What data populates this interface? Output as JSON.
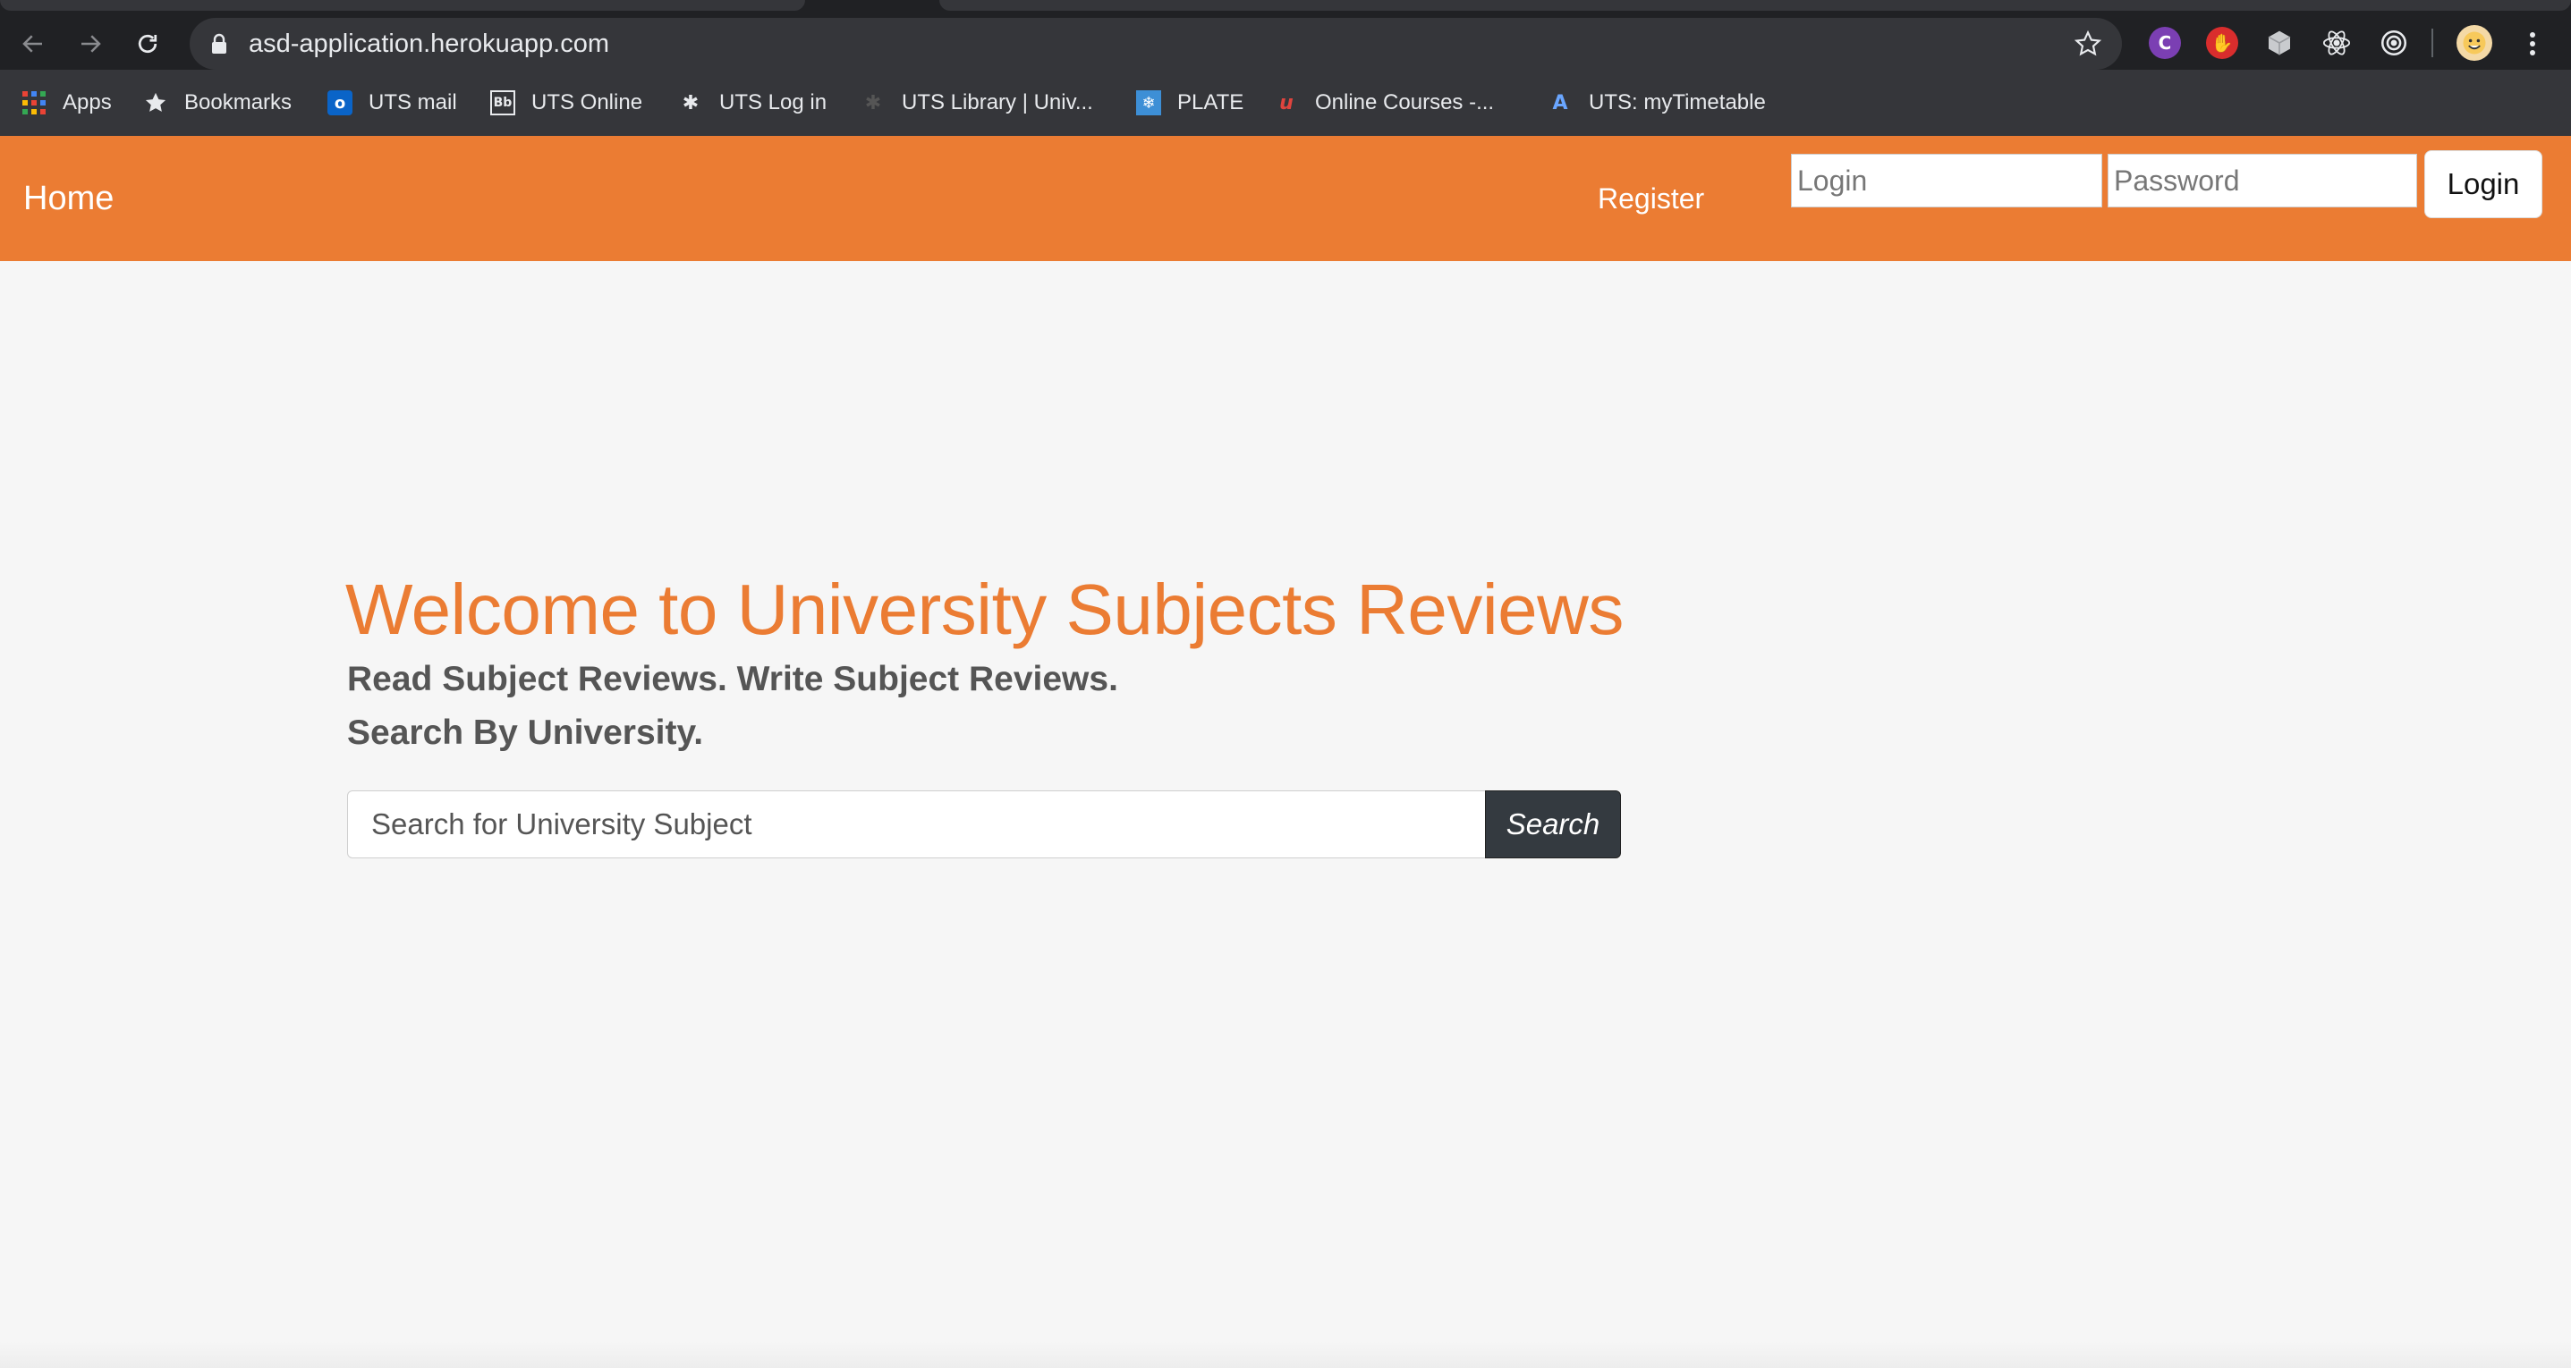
{
  "browser": {
    "url": "asd-application.herokuapp.com",
    "extensions": [
      "chrome-c-extension-icon",
      "adblock-icon",
      "cube-extension-icon",
      "react-devtools-icon",
      "target-extension-icon",
      "profile-avatar-icon"
    ]
  },
  "bookmarks": [
    {
      "label": "Apps",
      "icon": "apps-grid-icon"
    },
    {
      "label": "Bookmarks",
      "icon": "star-icon"
    },
    {
      "label": "UTS mail",
      "icon": "outlook-icon"
    },
    {
      "label": "UTS Online",
      "icon": "blackboard-icon"
    },
    {
      "label": "UTS Log in",
      "icon": "uts-shield-icon"
    },
    {
      "label": "UTS Library | Univ...",
      "icon": "uts-library-icon"
    },
    {
      "label": "PLATE",
      "icon": "plate-icon"
    },
    {
      "label": "Online Courses -...",
      "icon": "udemy-icon"
    },
    {
      "label": "UTS: myTimetable",
      "icon": "timetable-icon"
    }
  ],
  "nav": {
    "home": "Home",
    "register": "Register",
    "login_placeholder": "Login",
    "password_placeholder": "Password",
    "login_button": "Login"
  },
  "hero": {
    "title": "Welcome to University Subjects Reviews",
    "subtitle_line1": "Read Subject Reviews. Write Subject Reviews.",
    "subtitle_line2": "Search By University.",
    "search_placeholder": "Search for University Subject",
    "search_button": "Search"
  },
  "colors": {
    "accent": "#eb7c33",
    "page_background": "#f6f6f6",
    "search_button": "#343a40",
    "chrome_dark": "#202124"
  }
}
